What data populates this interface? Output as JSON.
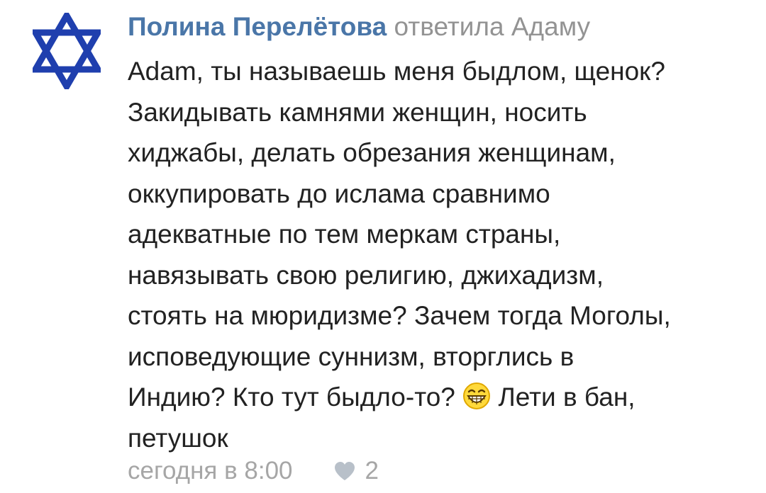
{
  "comment": {
    "author_name": "Полина Перелётова",
    "reply_label": "ответила Адаму",
    "text_before_emoji": "Adam, ты называешь меня быдлом, щенок?\nЗакидывать камнями женщин, носить\nхиджабы, делать обрезания женщинам,\nоккупировать до ислама сравнимо\nадекватные по тем меркам страны,\nнавязывать свою религию, джихадизм,\nстоять на мюридизме? Зачем тогда Моголы,\nисповедующие суннизм, вторглись в\nИндию? Кто тут быдло-то? ",
    "text_after_emoji": " Лети в бан,\nпетушок",
    "emoji_icon": "grinning-face-icon",
    "timestamp": "сегодня в 8:00",
    "like_icon": "heart-icon",
    "like_count": "2"
  },
  "colors": {
    "author": "#4a76a8",
    "secondary": "#939393",
    "text": "#222222",
    "avatar_star": "#1f3fae",
    "footer": "#a6a6a6"
  }
}
